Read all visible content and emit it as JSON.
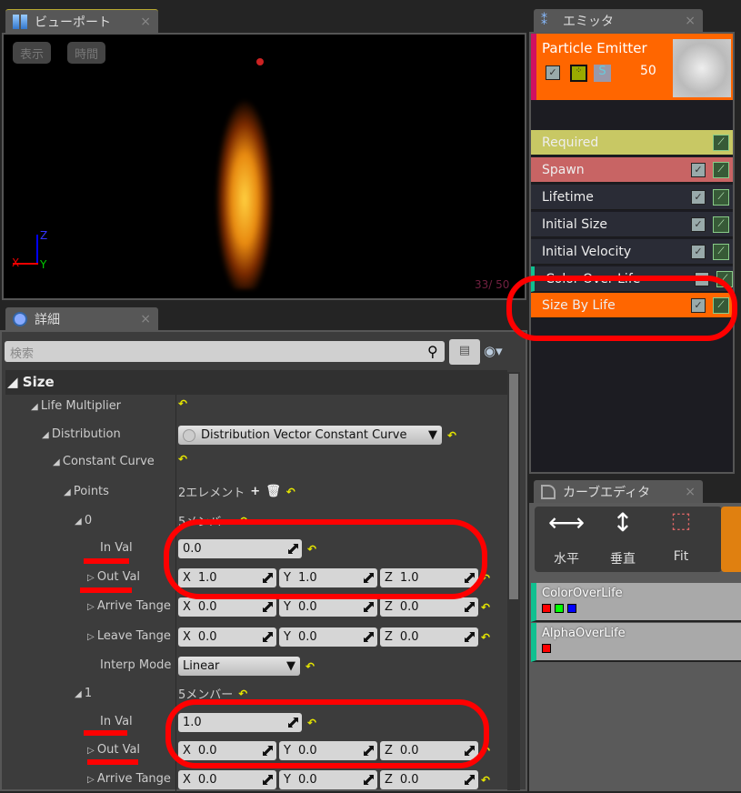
{
  "viewport": {
    "tab_label": "ビューポート",
    "show_button": "表示",
    "time_button": "時間",
    "axis_x": "X",
    "axis_y": "Y",
    "axis_z": "Z",
    "particle_count": "33/  50"
  },
  "details": {
    "tab_label": "詳細",
    "search_placeholder": "検索",
    "section": "Size",
    "rows": {
      "life_multiplier": "Life Multiplier",
      "distribution": "Distribution",
      "distribution_value": "Distribution Vector Constant Curve",
      "constant_curve": "Constant Curve",
      "points": "Points",
      "points_value": "2エレメント",
      "p0": "0",
      "p0_members": "5メンバー",
      "p0_inval_label": "In Val",
      "p0_inval": "0.0",
      "p0_outval_label": "Out Val",
      "p0_out_x": "1.0",
      "p0_out_y": "1.0",
      "p0_out_z": "1.0",
      "p0_arrive_label": "Arrive Tange",
      "p0_arr_x": "0.0",
      "p0_arr_y": "0.0",
      "p0_arr_z": "0.0",
      "p0_leave_label": "Leave Tange",
      "p0_lv_x": "0.0",
      "p0_lv_y": "0.0",
      "p0_lv_z": "0.0",
      "p0_interp_label": "Interp Mode",
      "p0_interp": "Linear",
      "p1": "1",
      "p1_members": "5メンバー",
      "p1_inval_label": "In Val",
      "p1_inval": "1.0",
      "p1_outval_label": "Out Val",
      "p1_out_x": "0.0",
      "p1_out_y": "0.0",
      "p1_out_z": "0.0",
      "p1_arrive_label": "Arrive Tange",
      "p1_arr_x": "0.0",
      "p1_arr_y": "0.0",
      "p1_arr_z": "0.0"
    },
    "axis": {
      "x": "X",
      "y": "Y",
      "z": "Z"
    },
    "reset_glyph": "↶"
  },
  "emitter": {
    "tab_label": "エミッタ",
    "name": "Particle Emitter",
    "count": "50",
    "solo": "S",
    "modules": [
      {
        "label": "Required",
        "color": "#c8c864"
      },
      {
        "label": "Spawn",
        "color": "#c86464"
      },
      {
        "label": "Lifetime",
        "color": "#2a2c36"
      },
      {
        "label": "Initial Size",
        "color": "#2a2c36"
      },
      {
        "label": "Initial Velocity",
        "color": "#2a2c36"
      },
      {
        "label": "Color Over Life",
        "color": "#2a2c36"
      },
      {
        "label": "Size By Life",
        "color": "#ff6600"
      }
    ]
  },
  "curve_editor": {
    "tab_label": "カーブエディタ",
    "tools": [
      "水平",
      "垂直",
      "Fit"
    ],
    "tracks": [
      {
        "label": "ColorOverLife"
      },
      {
        "label": "AlphaOverLife"
      }
    ]
  },
  "colors": {
    "accent": "#ff6600",
    "annotation": "#ff0000"
  }
}
